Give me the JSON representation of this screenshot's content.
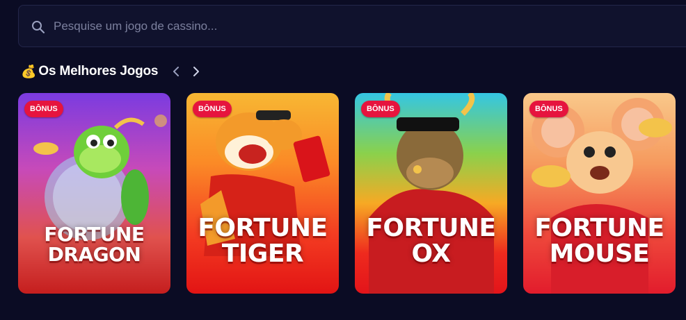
{
  "search": {
    "placeholder": "Pesquise um jogo de cassino...",
    "value": "",
    "icon": "search-icon"
  },
  "section": {
    "icon": "money-bag-icon",
    "icon_glyph": "💰",
    "title": "Os Melhores Jogos",
    "prev_icon": "chevron-left-icon",
    "next_icon": "chevron-right-icon"
  },
  "games": [
    {
      "badge": "BÔNUS",
      "title_line1": "FORTUNE",
      "title_line2": "DRAGON"
    },
    {
      "badge": "BÔNUS",
      "title_line1": "FORTUNE",
      "title_line2": "TIGER"
    },
    {
      "badge": "BÔNUS",
      "title_line1": "FORTUNE",
      "title_line2": "OX"
    },
    {
      "badge": "BÔNUS",
      "title_line1": "FORTUNE",
      "title_line2": "MOUSE"
    }
  ],
  "colors": {
    "background": "#0b0c24",
    "search_bg": "#10122d",
    "badge": "#e6143e"
  }
}
